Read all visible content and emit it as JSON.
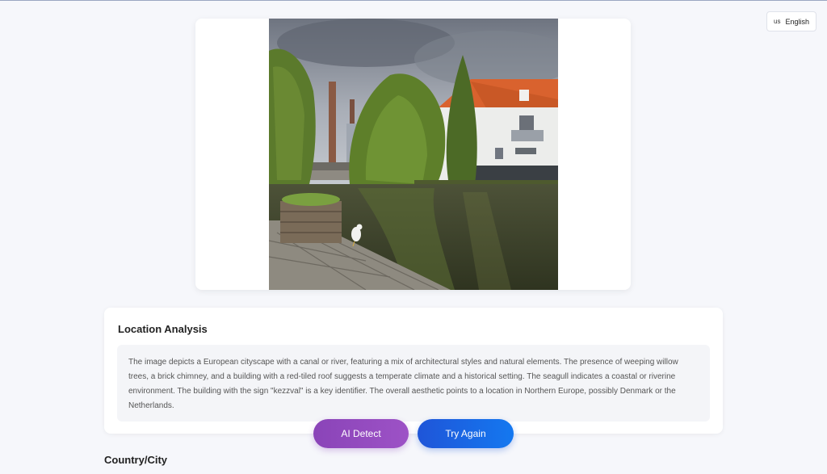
{
  "language": {
    "flag_code": "us",
    "label": "English"
  },
  "image": {
    "alt": "Canal scene with weeping willows, chimneys and a white building with red-tiled roof"
  },
  "analysis": {
    "title": "Location Analysis",
    "text": "The image depicts a European cityscape with a canal or river, featuring a mix of architectural styles and natural elements. The presence of weeping willow trees, a brick chimney, and a building with a red-tiled roof suggests a temperate climate and a historical setting. The seagull indicates a coastal or riverine environment. The building with the sign \"kezzval\" is a key identifier. The overall aesthetic points to a location in Northern Europe, possibly Denmark or the Netherlands."
  },
  "buttons": {
    "ai_detect": "AI Detect",
    "try_again": "Try Again"
  },
  "section": {
    "country_city": "Country/City"
  }
}
